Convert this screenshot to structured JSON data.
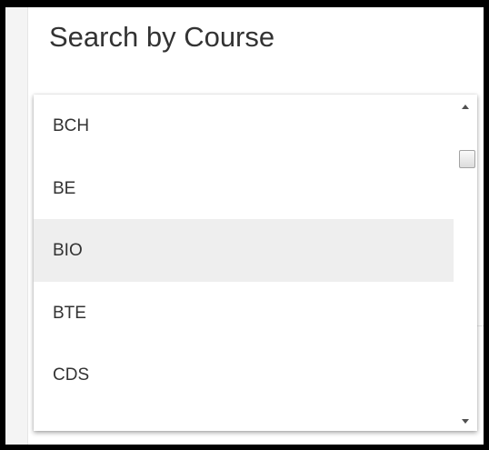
{
  "title": "Search by Course",
  "dropdown": {
    "options": [
      "BCH",
      "BE",
      "BIO",
      "BTE",
      "CDS",
      ""
    ],
    "hovered_option": "BIO"
  },
  "scrollbar": {
    "up_icon": "scroll-up-arrow-icon",
    "down_icon": "scroll-down-arrow-icon",
    "position_fraction": 0.1
  },
  "colors": {
    "hover_background": "#eeeeee",
    "text": "#333333",
    "page_background": "#ffffff",
    "outer_border": "#000000"
  }
}
